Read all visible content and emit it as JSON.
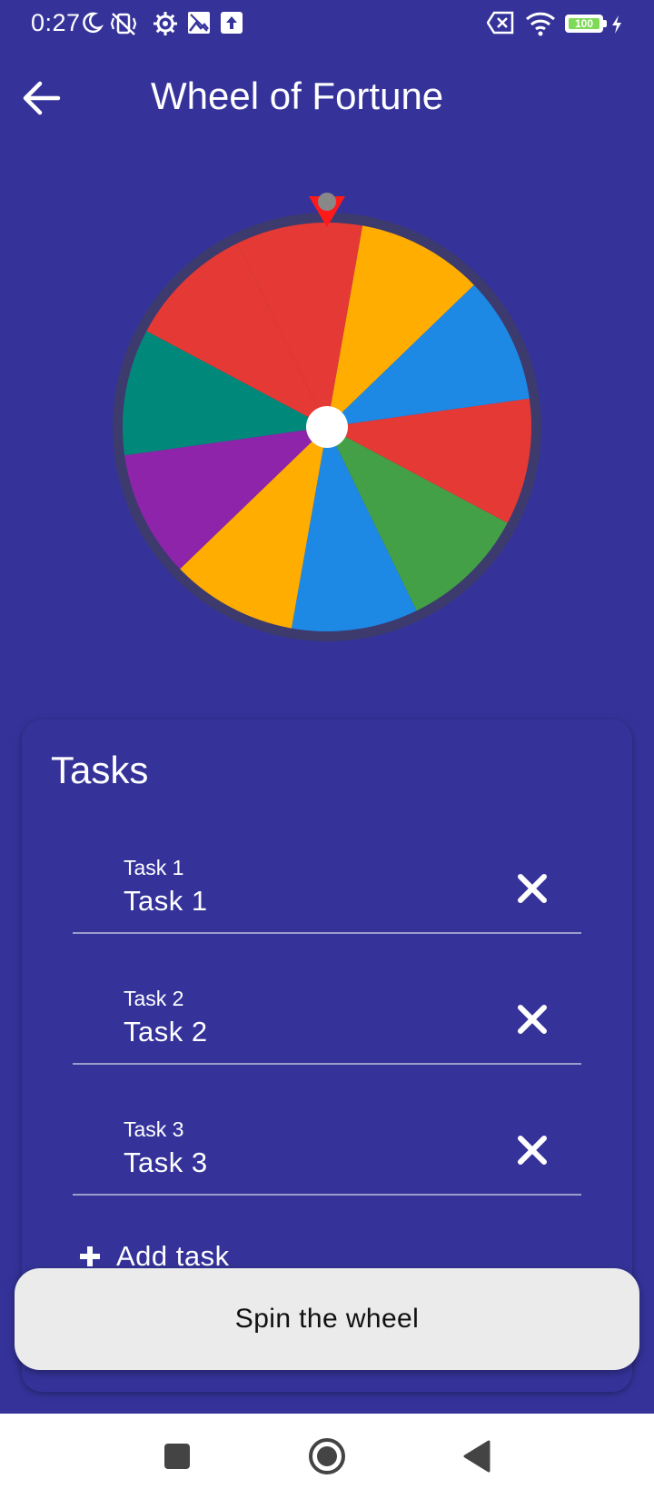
{
  "status_bar": {
    "time": "0:27",
    "battery": "100",
    "icons": [
      "moon-icon",
      "vibrate-off-icon",
      "gear-icon",
      "image-icon",
      "upload-icon",
      "no-sim-icon",
      "wifi-icon",
      "battery-icon",
      "charging-icon"
    ]
  },
  "app_bar": {
    "title": "Wheel of Fortune",
    "back_icon": "arrow-left-icon"
  },
  "wheel": {
    "segment_count": 10,
    "segments": [
      {
        "color": "#ffad00"
      },
      {
        "color": "#1e88e5"
      },
      {
        "color": "#e53935"
      },
      {
        "color": "#43a047"
      },
      {
        "color": "#1e88e5"
      },
      {
        "color": "#ffad00"
      },
      {
        "color": "#8e24aa"
      },
      {
        "color": "#00897b"
      },
      {
        "color": "#e53935"
      },
      {
        "color": "#e53935"
      }
    ],
    "rim_color": "#3d3a6d",
    "pointer_color": "#ff1a1a"
  },
  "tasks": {
    "title": "Tasks",
    "items": [
      {
        "label": "Task 1",
        "value": "Task 1"
      },
      {
        "label": "Task 2",
        "value": "Task 2"
      },
      {
        "label": "Task 3",
        "value": "Task 3"
      }
    ],
    "add_label": "Add task"
  },
  "spin": {
    "label": "Spin the wheel"
  },
  "colors": {
    "background": "#35339a",
    "button_bg": "#ebebeb"
  }
}
